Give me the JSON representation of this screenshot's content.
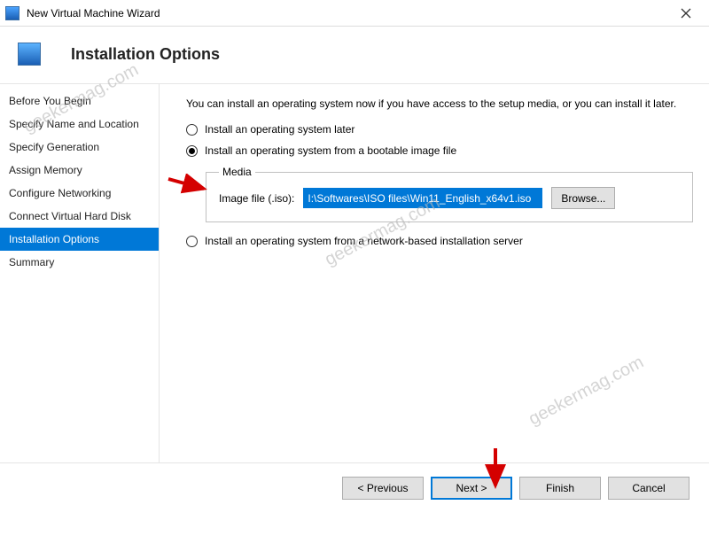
{
  "titlebar": {
    "title": "New Virtual Machine Wizard"
  },
  "header": {
    "heading": "Installation Options"
  },
  "sidebar": {
    "items": [
      {
        "label": "Before You Begin"
      },
      {
        "label": "Specify Name and Location"
      },
      {
        "label": "Specify Generation"
      },
      {
        "label": "Assign Memory"
      },
      {
        "label": "Configure Networking"
      },
      {
        "label": "Connect Virtual Hard Disk"
      },
      {
        "label": "Installation Options"
      },
      {
        "label": "Summary"
      }
    ],
    "active_index": 6
  },
  "content": {
    "intro": "You can install an operating system now if you have access to the setup media, or you can install it later.",
    "option_later": "Install an operating system later",
    "option_image": "Install an operating system from a bootable image file",
    "option_network": "Install an operating system from a network-based installation server",
    "media_legend": "Media",
    "media_label": "Image file (.iso):",
    "iso_value": "I:\\Softwares\\ISO files\\Win11_English_x64v1.iso",
    "browse_label": "Browse..."
  },
  "footer": {
    "previous": "< Previous",
    "next": "Next >",
    "finish": "Finish",
    "cancel": "Cancel"
  },
  "watermark": "geekermag.com"
}
